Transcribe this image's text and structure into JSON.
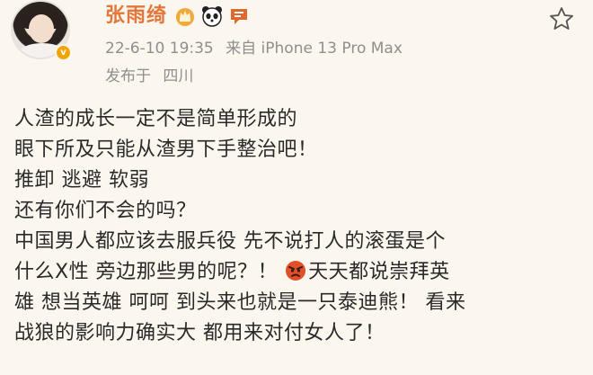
{
  "user": {
    "name": "张雨绮",
    "verified_mark": "v",
    "badges": [
      "crown-badge-icon",
      "panda-badge-icon",
      "chat-badge-icon"
    ]
  },
  "meta": {
    "time": "22-6-10 19:35",
    "source": "来自 iPhone 13 Pro Max",
    "location_prefix": "发布于",
    "location": "四川"
  },
  "post": {
    "lines": [
      "人渣的成长一定不是简单形成的",
      "眼下所及只能从渣男下手整治吧！",
      "推卸 逃避 软弱",
      "还有你们不会的吗？",
      "中国男人都应该去服兵役 先不说打人的滚蛋是个"
    ],
    "line6_before": "什么Ⅹ性 旁边那些男的呢？！",
    "line6_emoji": "angry-face-icon",
    "line6_after": "天天都说崇拜英",
    "line7": "雄 想当英雄 呵呵 到头来也就是一只泰迪熊！ 看来",
    "line8": "战狼的影响力确实大 都用来对付女人了！"
  },
  "colors": {
    "background": "#fbf6ee",
    "username": "#e3763a",
    "meta": "#8f8f8f",
    "text": "#2a2a2a",
    "verified": "#f0a500"
  }
}
